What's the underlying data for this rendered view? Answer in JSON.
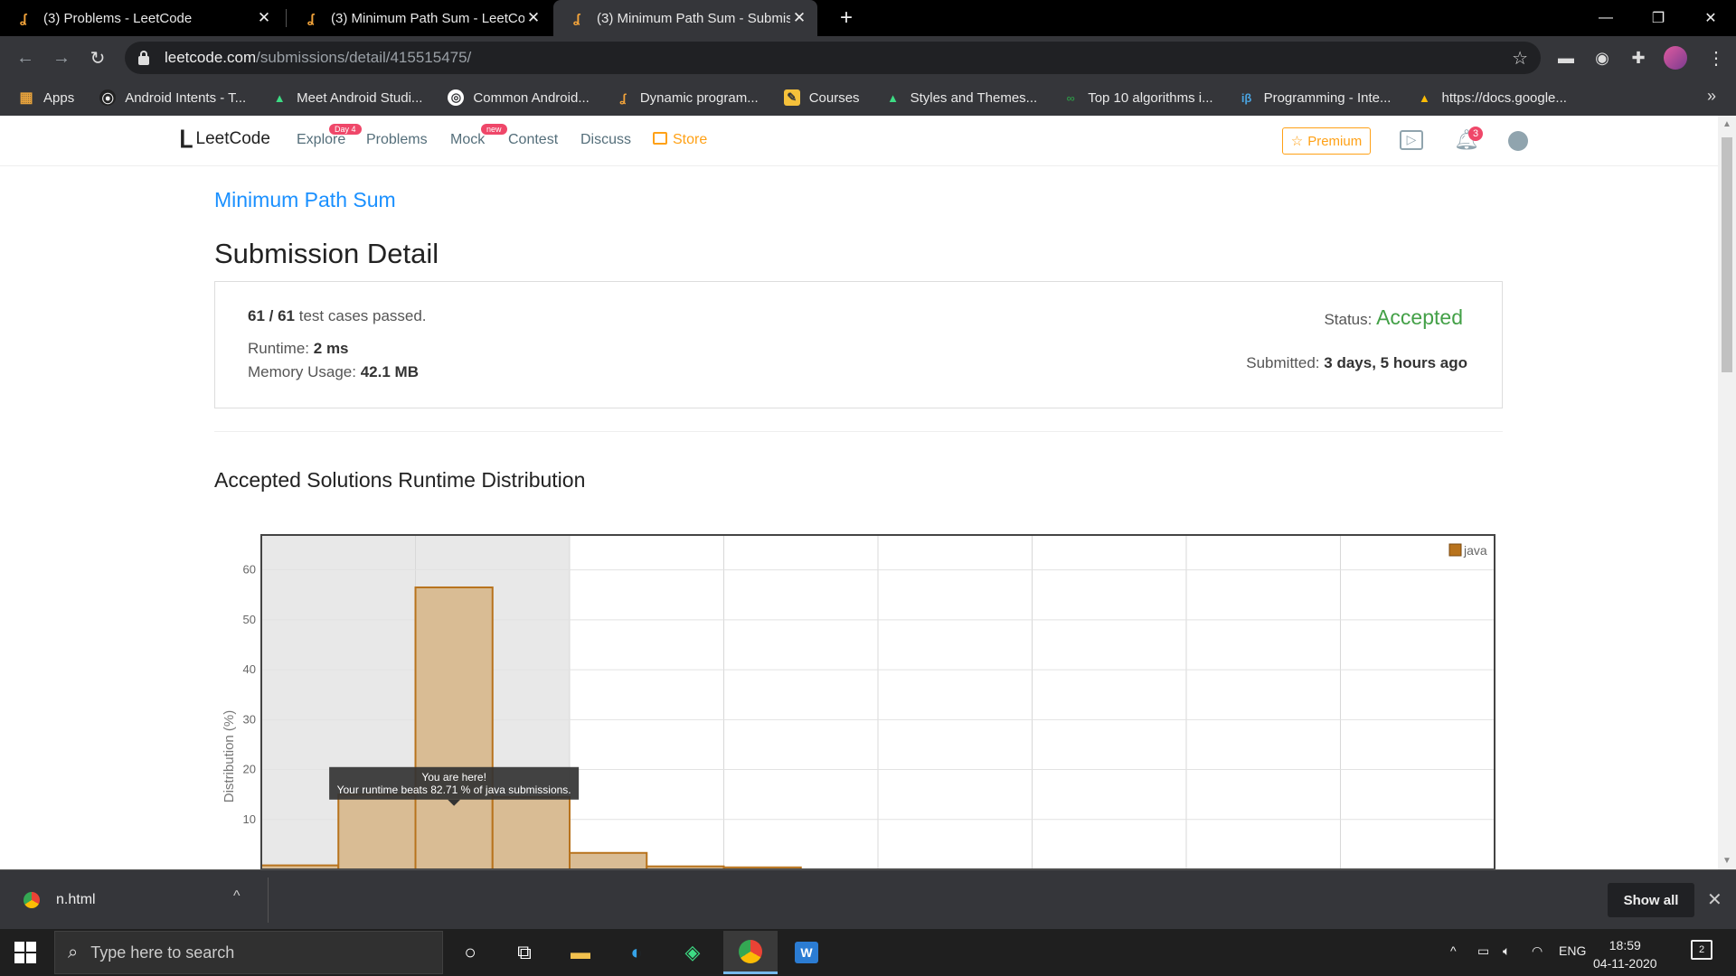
{
  "browser": {
    "tabs": [
      {
        "title": "(3) Problems - LeetCode",
        "active": false
      },
      {
        "title": "(3) Minimum Path Sum - LeetCod",
        "active": false
      },
      {
        "title": "(3) Minimum Path Sum - Submiss",
        "active": true
      }
    ],
    "url_host": "leetcode.com",
    "url_path": "/submissions/detail/415515475/",
    "bookmarks": [
      {
        "label": "Apps",
        "icon": "apps-grid-icon"
      },
      {
        "label": "Android Intents - T...",
        "icon": "android-intents-icon"
      },
      {
        "label": "Meet Android Studi...",
        "icon": "android-icon"
      },
      {
        "label": "Common Android...",
        "icon": "chrome-icon"
      },
      {
        "label": "Dynamic program...",
        "icon": "leetcode-icon"
      },
      {
        "label": "Courses",
        "icon": "pencil-icon"
      },
      {
        "label": "Styles and Themes...",
        "icon": "android-icon"
      },
      {
        "label": "Top 10 algorithms i...",
        "icon": "geeksforgeeks-icon"
      },
      {
        "label": "Programming - Inte...",
        "icon": "interviewbit-icon"
      },
      {
        "label": "https://docs.google...",
        "icon": "google-drive-icon"
      }
    ]
  },
  "nav": {
    "logo": "LeetCode",
    "links": {
      "explore": "Explore",
      "problems": "Problems",
      "mock": "Mock",
      "contest": "Contest",
      "discuss": "Discuss",
      "store": "Store"
    },
    "explore_badge": "Day 4",
    "mock_badge": "new",
    "premium": "Premium",
    "notifications": "3"
  },
  "submission": {
    "problem": "Minimum Path Sum",
    "heading": "Submission Detail",
    "passed": "61 / 61",
    "passed_suffix": "test cases passed.",
    "runtime_label": "Runtime:",
    "runtime": "2 ms",
    "memory_label": "Memory Usage:",
    "memory": "42.1 MB",
    "status_label": "Status:",
    "status": "Accepted",
    "submitted_label": "Submitted:",
    "submitted": "3 days, 5 hours ago"
  },
  "chart_title": "Accepted Solutions Runtime Distribution",
  "chart_data": {
    "type": "bar",
    "x": [
      0,
      1,
      2,
      3,
      4,
      5,
      6
    ],
    "values": [
      0.8,
      15,
      56.5,
      14.5,
      3.3,
      0.6,
      0.4
    ],
    "xlim": [
      0,
      16
    ],
    "xticks": [
      0,
      2,
      4,
      6,
      8,
      10,
      12,
      14,
      16
    ],
    "ylim": [
      0,
      67
    ],
    "yticks": [
      10,
      20,
      30,
      40,
      50,
      60
    ],
    "ylabel": "Distribution (%)",
    "xlabel": "",
    "highlight_range": [
      0,
      4
    ],
    "grid": true,
    "legend": "top-right",
    "series": [
      {
        "name": "java",
        "color": "#b8731d"
      }
    ],
    "tooltip": {
      "line1": "You are here!",
      "line2": "Your runtime beats 82.71 % of java submissions."
    }
  },
  "downloads": {
    "file": "n.html",
    "show_all": "Show all"
  },
  "taskbar": {
    "search_placeholder": "Type here to search",
    "lang": "ENG",
    "time": "18:59",
    "date": "04-11-2020",
    "notif_count": "2"
  }
}
